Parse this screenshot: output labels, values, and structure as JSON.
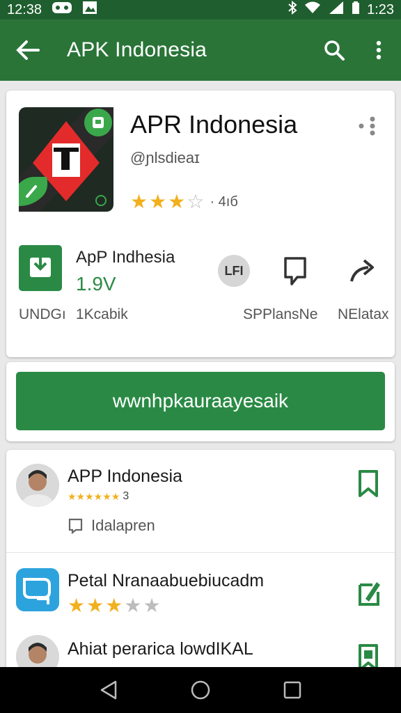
{
  "status_bar": {
    "time_left": "12:38",
    "time_right": "1:23"
  },
  "app_bar": {
    "title": "APK Indonesia",
    "icons": [
      "back-arrow-icon",
      "search-icon",
      "more-vert-icon"
    ]
  },
  "app_header": {
    "name": "APR Indonesia",
    "developer": "@ɲlsdieaɪ",
    "rating_stars": 3,
    "rating_max": 5,
    "rating_text": "· 4ıб"
  },
  "info_row": {
    "title": "ApP Indhesia",
    "version": "1.9V",
    "label_left": "UNDGı",
    "label_size": "1Kcabik",
    "circle_text": "LFI",
    "label_sp": "SPPlansNe",
    "label_related": "NElatax"
  },
  "install": {
    "label": "wwnhpkauraayesaik"
  },
  "list": {
    "items": [
      {
        "title": "APP Indonesia",
        "star_count": 6,
        "count": "3",
        "sub": "Idalapren"
      },
      {
        "title": "Petal Nranaabuebiucadm",
        "rating_stars": 3,
        "rating_max": 5
      },
      {
        "title": "Ahiat perarica lowdIKAL"
      }
    ]
  },
  "colors": {
    "status_bar": "#1f5e2e",
    "app_bar": "#2a7438",
    "accent": "#2a8a45",
    "star": "#f2b01e"
  }
}
